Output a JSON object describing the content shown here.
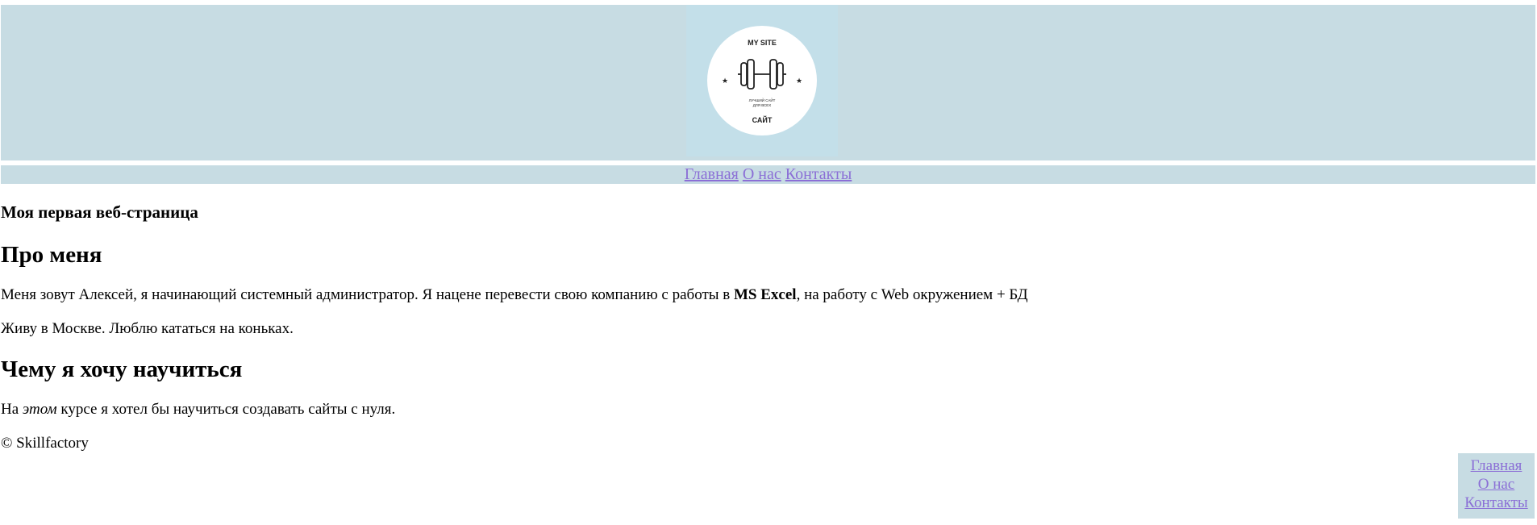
{
  "header": {
    "logo": {
      "top_text": "MY SITE",
      "tagline_line1": "ЛУЧШИЙ САЙТ",
      "tagline_line2": "ДЛЯ ВСЕХ",
      "bottom_text": "САЙТ",
      "icon": "dumbbell-icon"
    }
  },
  "nav": {
    "items": [
      {
        "label": "Главная"
      },
      {
        "label": "О нас"
      },
      {
        "label": "Контакты"
      }
    ]
  },
  "main": {
    "page_heading": "Моя первая веб-страница",
    "about": {
      "heading": "Про меня",
      "p1_before": "Меня зовут Алексей, я начинающий системный администратор. Я нацене перевести свою компанию с работы в ",
      "p1_bold": "MS Excel",
      "p1_after": ", на работу с Web окружением + БД",
      "p2": "Живу в Москве. Люблю кататься на коньках."
    },
    "learn": {
      "heading": "Чему я хочу научиться",
      "p_before": "На ",
      "p_italic": "этом",
      "p_after": " курсе я хотел бы научиться создавать сайты с нуля."
    },
    "footer": "© Skillfactory"
  },
  "colors": {
    "header_bg": "#c7dce3",
    "link": "#8b6fd6"
  }
}
